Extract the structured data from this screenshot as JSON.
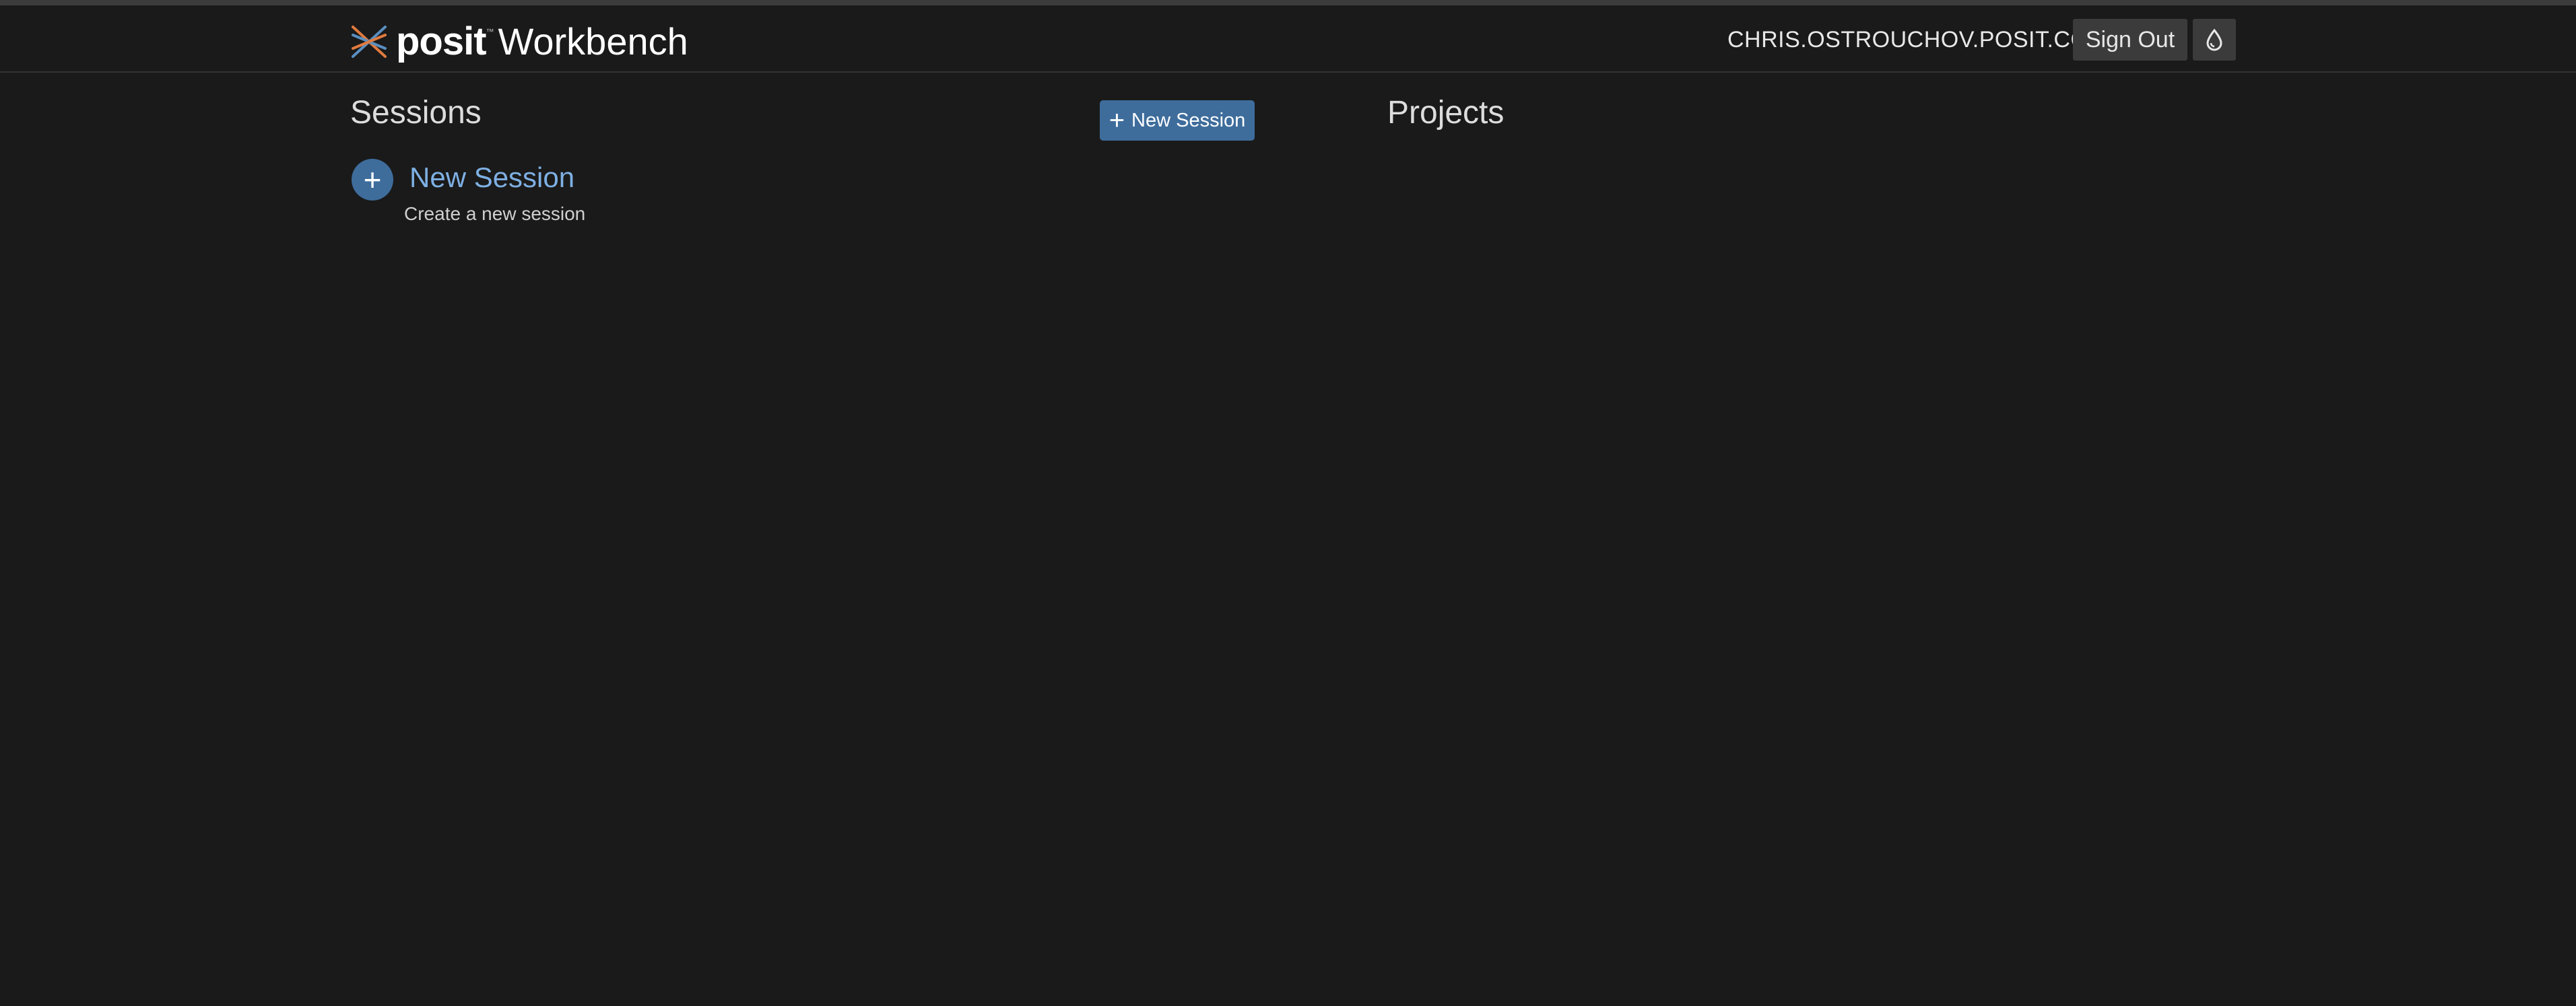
{
  "header": {
    "logo_brand": "posit",
    "logo_tm": "™",
    "logo_product": "Workbench",
    "user_name": "CHRIS.OSTROUCHOV.POSIT.CO",
    "sign_out_label": "Sign Out",
    "theme_icon": "drop-icon"
  },
  "sessions": {
    "title": "Sessions",
    "new_session_button_label": "New Session",
    "items": [
      {
        "name": "New Session",
        "description": "Create a new session",
        "icon": "plus-icon"
      }
    ]
  },
  "projects": {
    "title": "Projects"
  },
  "colors": {
    "background": "#1a1a1a",
    "accent": "#3e6d9c",
    "link": "#7eb0e3",
    "logo_orange": "#e07a3e",
    "logo_blue": "#5a8fc0"
  }
}
